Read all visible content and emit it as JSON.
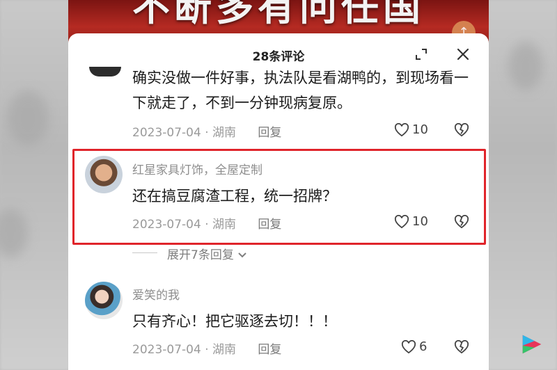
{
  "video": {
    "caption": "不断多有问任国"
  },
  "panel": {
    "title": "28条评论"
  },
  "comments": [
    {
      "text": "确实没做一件好事，执法队是看湖鸭的，到现场看一下就走了，不到一分钟现病复原。",
      "date": "2023-07-04",
      "location": "湖南",
      "reply": "回复",
      "likes": "10"
    },
    {
      "user": "红星家具灯饰，全屋定制",
      "text": "还在搞豆腐渣工程，统一招牌？",
      "date": "2023-07-04",
      "location": "湖南",
      "reply": "回复",
      "likes": "10",
      "expand": "展开7条回复"
    },
    {
      "user": "爱笑的我",
      "text": "只有齐心！把它驱逐去切！！！",
      "date": "2023-07-04",
      "location": "湖南",
      "reply": "回复",
      "likes": "6"
    }
  ],
  "colors": {
    "highlight": "#e0242a",
    "video_bg": "#b52a22",
    "panel_bg": "#ffffff"
  },
  "icons": [
    "expand-icon",
    "close-icon",
    "heart-icon",
    "broken-heart-icon",
    "chevron-down-icon",
    "app-logo-icon"
  ]
}
